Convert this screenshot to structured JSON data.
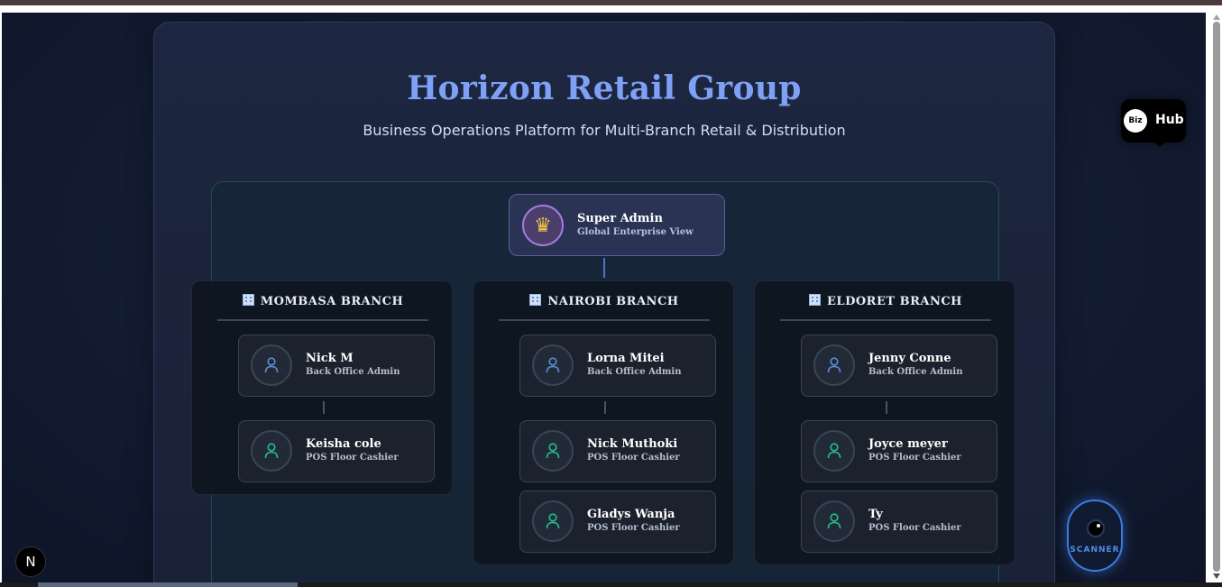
{
  "header": {
    "title": "Horizon Retail Group",
    "subtitle": "Business Operations Platform for Multi-Branch Retail & Distribution"
  },
  "super_admin": {
    "name": "Super Admin",
    "role": "Global Enterprise View",
    "icon": "crown-icon"
  },
  "branches": [
    {
      "name": "MOMBASA BRANCH",
      "staff": [
        {
          "name": "Nick M",
          "role": "Back Office Admin"
        },
        {
          "name": "Keisha cole",
          "role": "POS Floor Cashier"
        }
      ]
    },
    {
      "name": "NAIROBI BRANCH",
      "staff": [
        {
          "name": "Lorna Mitei",
          "role": "Back Office Admin"
        },
        {
          "name": "Nick Muthoki",
          "role": "POS Floor Cashier"
        },
        {
          "name": "Gladys Wanja",
          "role": "POS Floor Cashier"
        }
      ]
    },
    {
      "name": "ELDORET BRANCH",
      "staff": [
        {
          "name": "Jenny Conne",
          "role": "Back Office Admin"
        },
        {
          "name": "Joyce meyer",
          "role": "POS Floor Cashier"
        },
        {
          "name": "Ty",
          "role": "POS Floor Cashier"
        }
      ]
    }
  ],
  "bizhub": {
    "badge": "Biz",
    "label": "Hub"
  },
  "scanner": {
    "label": "SCANNER"
  },
  "next_badge": {
    "label": "N"
  },
  "colors": {
    "title": "#7ea0f5",
    "admin_icon": "#5b8fd6",
    "cashier_icon": "#22c08a",
    "accent": "#3d7be0"
  }
}
